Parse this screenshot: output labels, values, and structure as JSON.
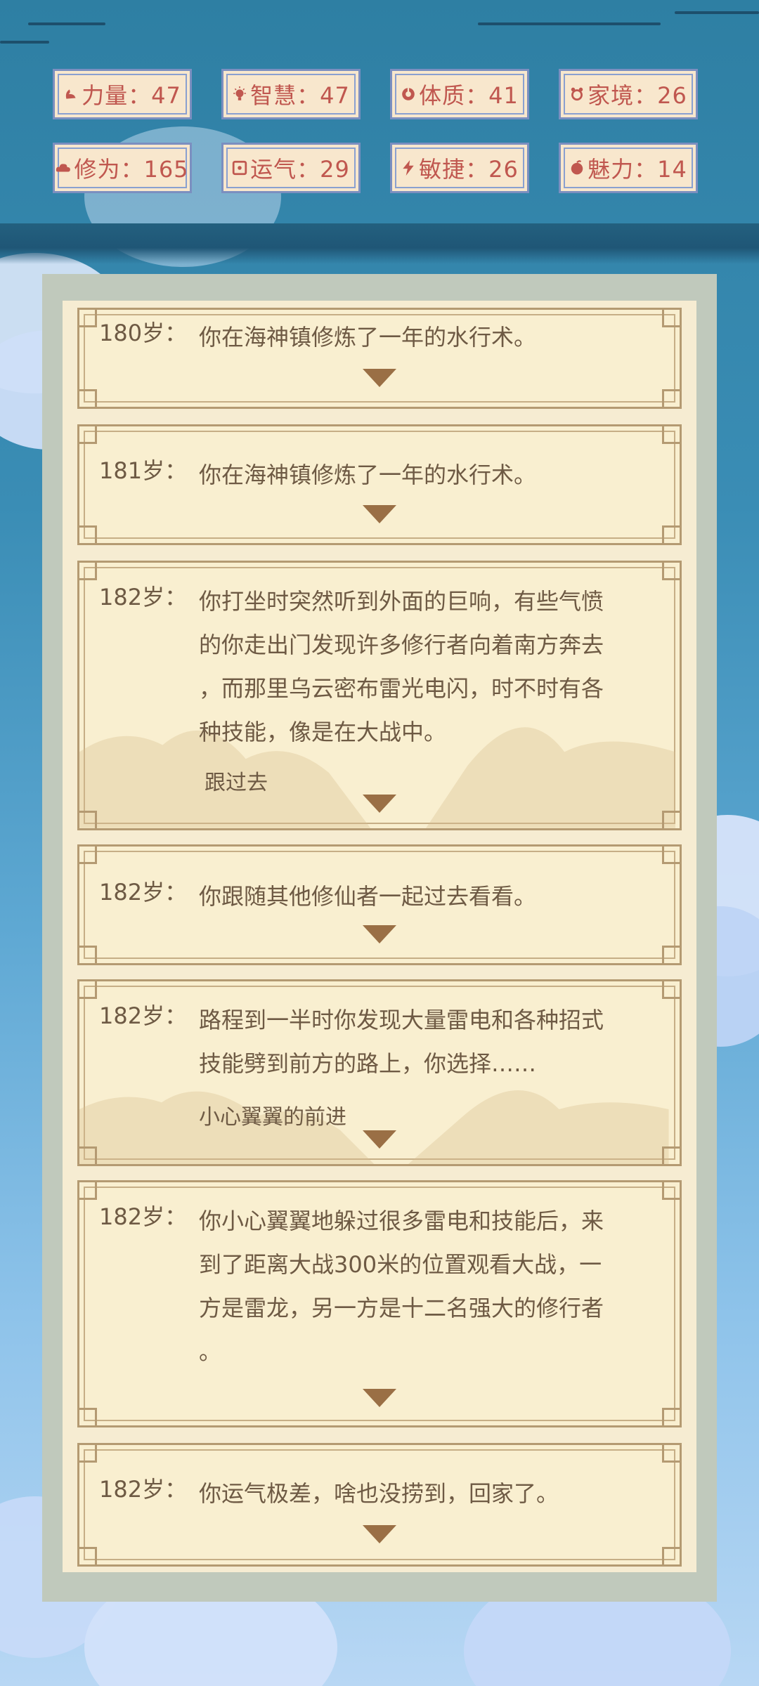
{
  "stats": [
    {
      "icon": "strength-icon",
      "text": "力量：47"
    },
    {
      "icon": "lightbulb-icon",
      "text": "智慧：47"
    },
    {
      "icon": "physique-icon",
      "text": "体质：41"
    },
    {
      "icon": "family-icon",
      "text": "家境：26"
    },
    {
      "icon": "cultivation-cloud-icon",
      "text": "修为：165"
    },
    {
      "icon": "luck-icon",
      "text": "运气：29"
    },
    {
      "icon": "lightning-icon",
      "text": "敏捷：26"
    },
    {
      "icon": "charm-icon",
      "text": "魅力：14"
    }
  ],
  "log": [
    {
      "age": "180岁：",
      "lines": [
        "你在海神镇修炼了一年的水行术。"
      ],
      "choice": ""
    },
    {
      "age": "181岁：",
      "lines": [
        "你在海神镇修炼了一年的水行术。"
      ],
      "choice": ""
    },
    {
      "age": "182岁：",
      "lines": [
        "你打坐时突然听到外面的巨响，有些气愤",
        "的你走出门发现许多修行者向着南方奔去",
        "，而那里乌云密布雷光电闪，时不时有各",
        "种技能，像是在大战中。"
      ],
      "choice": "跟过去"
    },
    {
      "age": "182岁：",
      "lines": [
        "你跟随其他修仙者一起过去看看。"
      ],
      "choice": ""
    },
    {
      "age": "182岁：",
      "lines": [
        "路程到一半时你发现大量雷电和各种招式",
        "技能劈到前方的路上，你选择……"
      ],
      "choice": "小心翼翼的前进"
    },
    {
      "age": "182岁：",
      "lines": [
        "你小心翼翼地躲过很多雷电和技能后，来",
        "到了距离大战300米的位置观看大战，一",
        "方是雷龙，另一方是十二名强大的修行者",
        "。"
      ],
      "choice": ""
    },
    {
      "age": "182岁：",
      "lines": [
        "你运气极差，啥也没捞到，回家了。"
      ],
      "choice": ""
    }
  ],
  "colors": {
    "stat_text": "#c0574f",
    "log_text": "#6e5a44",
    "arrow": "#9a6f45"
  }
}
